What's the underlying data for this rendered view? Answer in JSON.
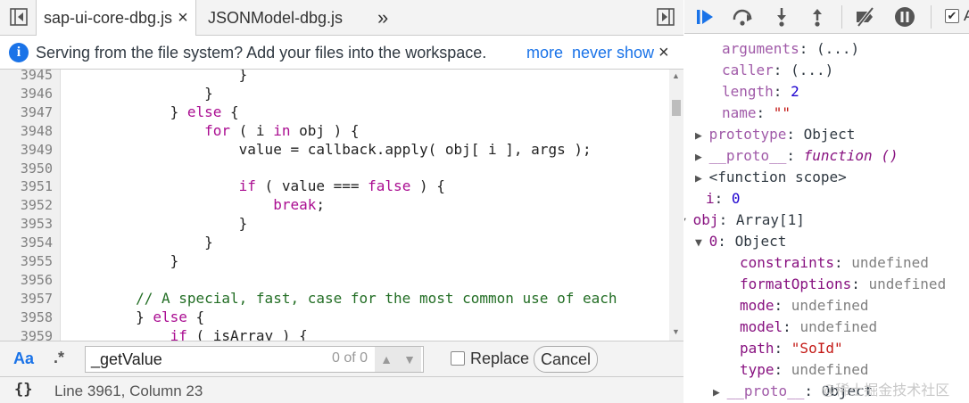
{
  "tabs": {
    "active_label": "sap-ui-core-dbg.js",
    "close_glyph": "×",
    "second_label": "JSONModel-dbg.js",
    "overflow_glyph": "»"
  },
  "infobar": {
    "message": "Serving from the file system? Add your files into the workspace.",
    "more": "more",
    "never_show": "never show",
    "close": "×"
  },
  "editor": {
    "lines": [
      {
        "num": "3945",
        "html": "                    }"
      },
      {
        "num": "3946",
        "html": "                }"
      },
      {
        "num": "3947",
        "html": "            } <span class=\"kw\">else</span> {"
      },
      {
        "num": "3948",
        "html": "                <span class=\"kw\">for</span> ( i <span class=\"kw\">in</span> obj ) {"
      },
      {
        "num": "3949",
        "html": "                    value = callback.apply( obj[ i ], args );"
      },
      {
        "num": "3950",
        "html": ""
      },
      {
        "num": "3951",
        "html": "                    <span class=\"kw\">if</span> ( value === <span class=\"kw\">false</span> ) {"
      },
      {
        "num": "3952",
        "html": "                        <span class=\"kw\">break</span>;"
      },
      {
        "num": "3953",
        "html": "                    }"
      },
      {
        "num": "3954",
        "html": "                }"
      },
      {
        "num": "3955",
        "html": "            }"
      },
      {
        "num": "3956",
        "html": ""
      },
      {
        "num": "3957",
        "html": "        <span class=\"cm\">// A special, fast, case for the most common use of each</span>"
      },
      {
        "num": "3958",
        "html": "        } <span class=\"kw\">else</span> {"
      },
      {
        "num": "3959",
        "html": "            <span class=\"kw\">if</span> ( isArray ) {"
      }
    ]
  },
  "search": {
    "case_label": "Aa",
    "regex_label": ".*",
    "query": "_getValue",
    "count": "0 of 0",
    "replace_label": "Replace",
    "cancel_label": "Cancel"
  },
  "status": {
    "braces": "{}",
    "position": "Line 3961, Column 23"
  },
  "debugger": {
    "pause_exceptions_label": "A"
  },
  "scope": [
    {
      "indent": 42,
      "tri": "",
      "key": "arguments",
      "keyclass": "kdim",
      "val": "(...)",
      "valclass": ""
    },
    {
      "indent": 42,
      "tri": "",
      "key": "caller",
      "keyclass": "kdim",
      "val": "(...)",
      "valclass": ""
    },
    {
      "indent": 42,
      "tri": "",
      "key": "length",
      "keyclass": "kdim",
      "val": "2",
      "valclass": "num"
    },
    {
      "indent": 42,
      "tri": "",
      "key": "name",
      "keyclass": "kdim",
      "val": "\"\"",
      "valclass": "str"
    },
    {
      "indent": 28,
      "tri": "▶",
      "key": "prototype",
      "keyclass": "kdim",
      "val": "Object",
      "valclass": ""
    },
    {
      "indent": 28,
      "tri": "▶",
      "key": "__proto__",
      "keyclass": "kdim",
      "val": "function ()",
      "valclass": "fn"
    },
    {
      "indent": 28,
      "tri": "▶",
      "key": "<function scope>",
      "keyclass": "",
      "val": "",
      "valclass": ""
    },
    {
      "indent": 24,
      "tri": "",
      "key": "i",
      "keyclass": "k",
      "val": "0",
      "valclass": "num"
    },
    {
      "indent": 10,
      "tri": "▼",
      "key": "obj",
      "keyclass": "k",
      "val": "Array[1]",
      "valclass": ""
    },
    {
      "indent": 28,
      "tri": "▼",
      "key": "0",
      "keyclass": "k",
      "val": "Object",
      "valclass": ""
    },
    {
      "indent": 62,
      "tri": "",
      "key": "constraints",
      "keyclass": "k",
      "val": "undefined",
      "valclass": "undef"
    },
    {
      "indent": 62,
      "tri": "",
      "key": "formatOptions",
      "keyclass": "k",
      "val": "undefined",
      "valclass": "undef"
    },
    {
      "indent": 62,
      "tri": "",
      "key": "mode",
      "keyclass": "k",
      "val": "undefined",
      "valclass": "undef"
    },
    {
      "indent": 62,
      "tri": "",
      "key": "model",
      "keyclass": "k",
      "val": "undefined",
      "valclass": "undef"
    },
    {
      "indent": 62,
      "tri": "",
      "key": "path",
      "keyclass": "k",
      "val": "\"SoId\"",
      "valclass": "str"
    },
    {
      "indent": 62,
      "tri": "",
      "key": "type",
      "keyclass": "k",
      "val": "undefined",
      "valclass": "undef"
    },
    {
      "indent": 48,
      "tri": "▶",
      "key": "__proto__",
      "keyclass": "kdim",
      "val": "Object",
      "valclass": ""
    }
  ],
  "watermark": "@稀土掘金技术社区",
  "colors": {
    "link_blue": "#1a73e8",
    "keyword": "#aa0d91",
    "comment": "#236e25",
    "number": "#1c00cf",
    "string": "#c41a16"
  }
}
